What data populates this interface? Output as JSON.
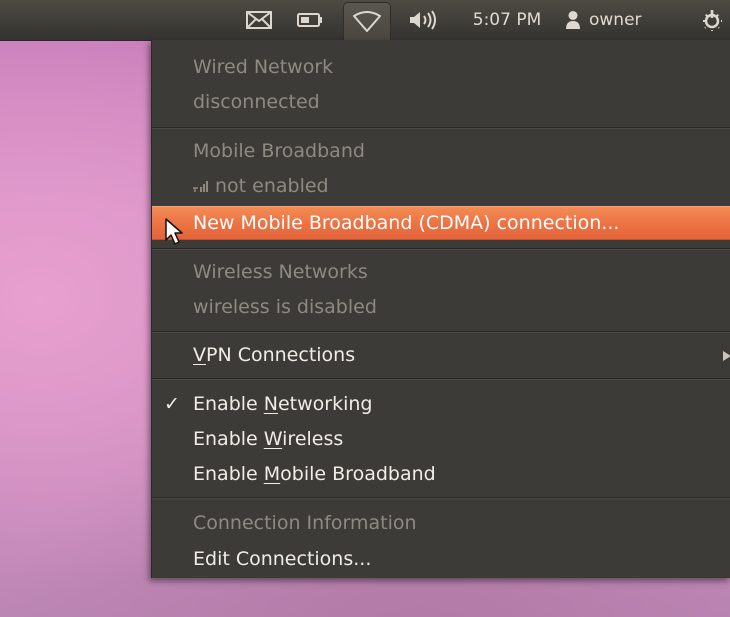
{
  "panel": {
    "icons": [
      "mail-icon",
      "battery-icon",
      "wifi-icon",
      "volume-icon",
      "user-icon",
      "power-icon"
    ],
    "time": "5:07 PM",
    "user": "owner"
  },
  "menu": {
    "wired": {
      "title": "Wired Network",
      "status": "disconnected"
    },
    "mobile": {
      "title": "Mobile Broadband",
      "status": "not enabled",
      "new_connection": "New Mobile Broadband (CDMA) connection..."
    },
    "wireless": {
      "title": "Wireless Networks",
      "status": "wireless is disabled"
    },
    "vpn": {
      "pre": "",
      "u": "V",
      "post": "PN Connections"
    },
    "enable_networking": {
      "pre": "Enable ",
      "u": "N",
      "post": "etworking",
      "checked": true
    },
    "enable_wireless": {
      "pre": "Enable ",
      "u": "W",
      "post": "ireless"
    },
    "enable_mobile": {
      "pre": "Enable ",
      "u": "M",
      "post": "obile Broadband"
    },
    "connection_info": "Connection Information",
    "edit_connections": "Edit Connections..."
  },
  "colors": {
    "panel_bg": "#3e3c37",
    "menu_bg": "#3c3b37",
    "highlight": "#ec7243",
    "text": "#f0ede6",
    "disabled_text": "#8e8a82"
  }
}
